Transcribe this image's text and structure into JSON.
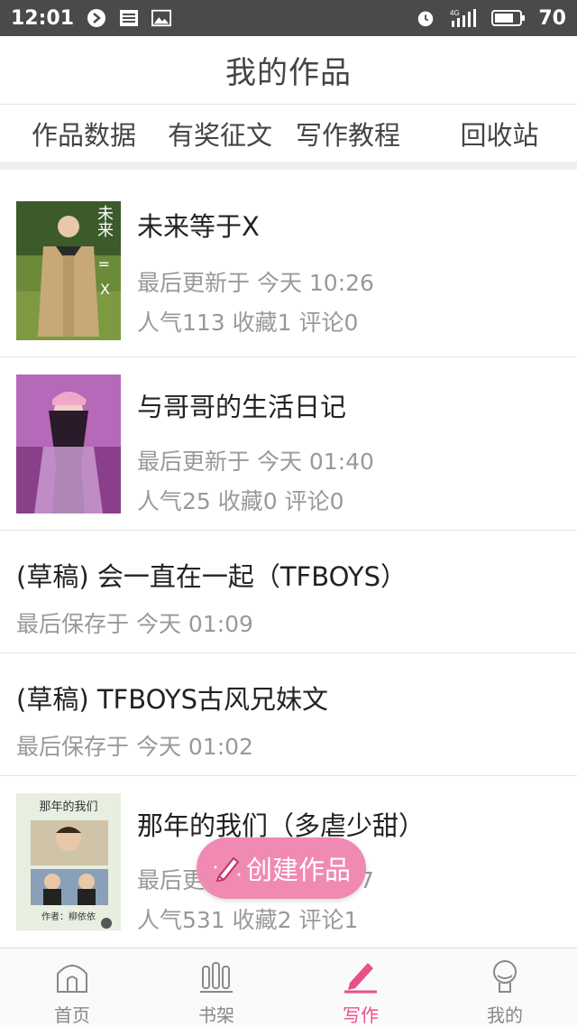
{
  "status_bar": {
    "time": "12:01",
    "battery": "70",
    "network": "4G"
  },
  "header": {
    "title": "我的作品"
  },
  "tabs": [
    {
      "label": "作品数据"
    },
    {
      "label": "有奖征文"
    },
    {
      "label": "写作教程"
    },
    {
      "label": "回收站"
    }
  ],
  "works": [
    {
      "title": "未来等于X",
      "updated": "最后更新于 今天 10:26",
      "stats": "人气113 收藏1 评论0",
      "cover_text_1": "未来",
      "cover_text_2": "=",
      "cover_text_3": "X"
    },
    {
      "title": "与哥哥的生活日记",
      "updated": "最后更新于 今天 01:40",
      "stats": "人气25 收藏0 评论0"
    },
    {
      "title": "(草稿) 会一直在一起（TFBOYS）",
      "saved": "最后保存于 今天 01:09"
    },
    {
      "title": "(草稿) TFBOYS古风兄妹文",
      "saved": "最后保存于 今天 01:02"
    },
    {
      "title": "那年的我们（多虐少甜）",
      "updated": "最后更新于 今天 00:27",
      "stats": "人气531 收藏2 评论1",
      "cover_text_1": "那年的我们",
      "cover_text_2": "作者：柳依依"
    }
  ],
  "fab": {
    "label": "创建作品"
  },
  "bottom_nav": [
    {
      "label": "首页",
      "icon": "home-icon"
    },
    {
      "label": "书架",
      "icon": "bookshelf-icon"
    },
    {
      "label": "写作",
      "icon": "pen-icon",
      "active": true
    },
    {
      "label": "我的",
      "icon": "profile-icon"
    }
  ],
  "colors": {
    "accent": "#e8508a",
    "fab": "#f08ab2",
    "status_bar": "#4a4a4a",
    "meta_text": "#999999"
  }
}
